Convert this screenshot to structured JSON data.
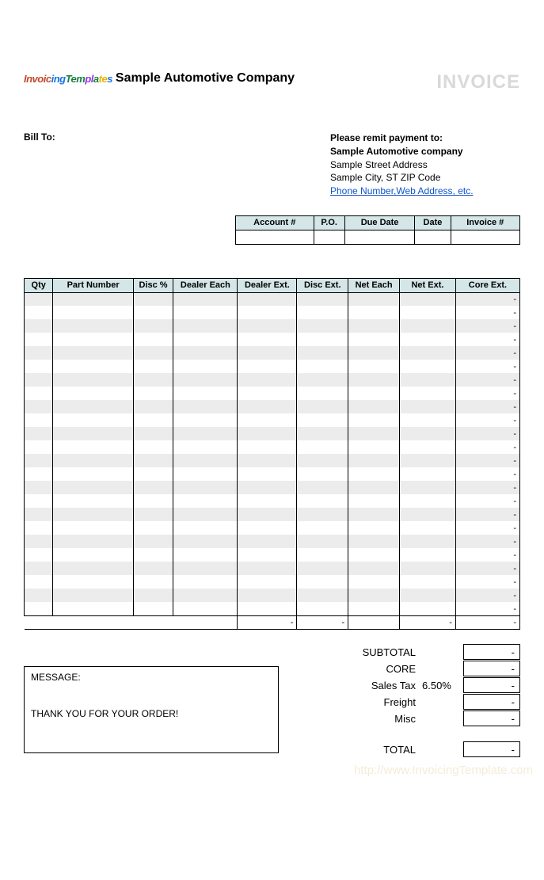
{
  "logo_text": "InvoicingTemplates",
  "company_name": "Sample Automotive Company",
  "invoice_title": "INVOICE",
  "bill_to_label": "Bill To:",
  "remit": {
    "title": "Please remit payment to:",
    "company": "Sample Automotive company",
    "street": "Sample Street Address",
    "city": "Sample City, ST  ZIP Code",
    "contact_link": "Phone Number,Web Address, etc."
  },
  "meta": {
    "headers": [
      "Account #",
      "P.O.",
      "Due Date",
      "Date",
      "Invoice #"
    ],
    "values": [
      "",
      "",
      "",
      "",
      ""
    ]
  },
  "columns": [
    "Qty",
    "Part Number",
    "Disc %",
    "Dealer Each",
    "Dealer Ext.",
    "Disc Ext.",
    "Net Each",
    "Net Ext.",
    "Core Ext."
  ],
  "row_count": 24,
  "row_dash": "-",
  "col_totals": {
    "dealer_ext": "-",
    "disc_ext": "-",
    "net_ext": "-",
    "core_ext": "-"
  },
  "totals": {
    "subtotal_label": "SUBTOTAL",
    "subtotal_value": "-",
    "core_label": "CORE",
    "core_value": "-",
    "tax_label": "Sales Tax",
    "tax_rate": "6.50%",
    "tax_value": "-",
    "freight_label": "Freight",
    "freight_value": "-",
    "misc_label": "Misc",
    "misc_value": "-",
    "total_label": "TOTAL",
    "total_value": "-"
  },
  "message": {
    "label": "MESSAGE:",
    "thanks": "THANK YOU FOR YOUR ORDER!"
  },
  "watermark": "http://www.InvoicingTemplate.com"
}
